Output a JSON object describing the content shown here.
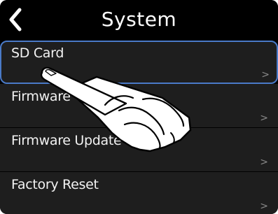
{
  "header": {
    "title": "System",
    "back_icon": "chevron-left-icon"
  },
  "menu": {
    "items": [
      {
        "label": "SD Card",
        "chevron": ">",
        "selected": true
      },
      {
        "label": "Firmware Version",
        "chevron": ">"
      },
      {
        "label": "Firmware Update",
        "chevron": ">"
      },
      {
        "label": "Factory Reset",
        "chevron": ">"
      }
    ]
  },
  "overlay": {
    "icon": "pointing-hand-icon"
  },
  "colors": {
    "background": "#000000",
    "row": "#1e1e1e",
    "selection_border": "#4a7ac8",
    "text": "#f2f2f2",
    "chevron": "#8a8a8a"
  }
}
